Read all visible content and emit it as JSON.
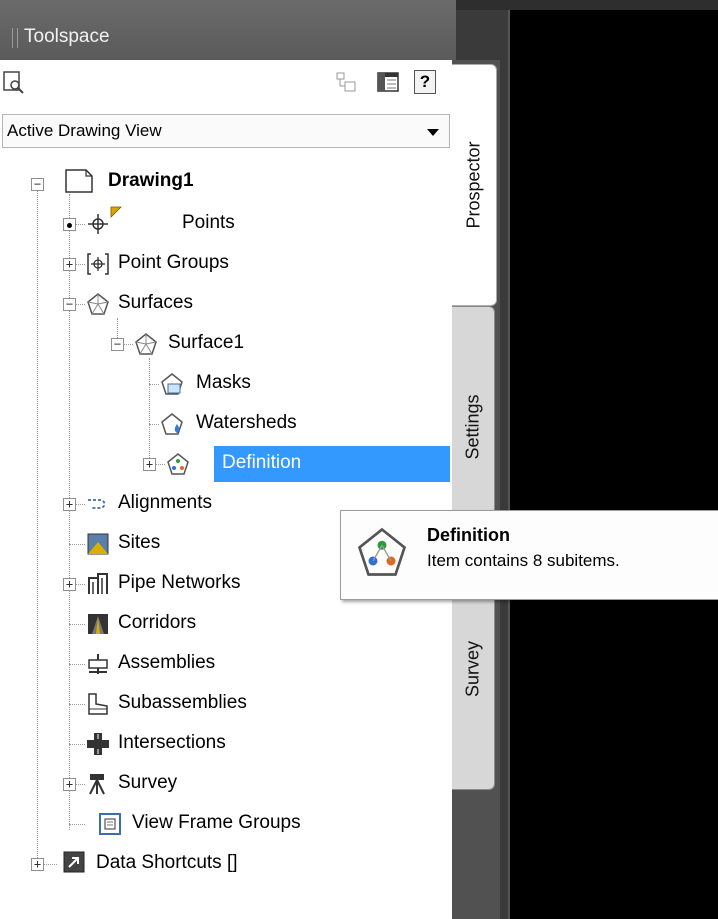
{
  "window": {
    "title": "Toolspace"
  },
  "toolbar": {
    "search_icon": "document-search-icon",
    "icons": [
      "hierarchy-view-icon",
      "item-view-icon",
      "help-icon"
    ],
    "help_label": "?"
  },
  "view_select": {
    "value": "Active Drawing View"
  },
  "tabs": [
    {
      "label": "Prospector",
      "active": true
    },
    {
      "label": "Settings",
      "active": false
    },
    {
      "label": "Survey",
      "active": false
    }
  ],
  "tree": {
    "root": "Drawing1",
    "points": "Points",
    "point_groups": "Point Groups",
    "surfaces": "Surfaces",
    "surface1": "Surface1",
    "masks": "Masks",
    "watersheds": "Watersheds",
    "definition": "Definition",
    "alignments": "Alignments",
    "sites": "Sites",
    "pipe_networks": "Pipe Networks",
    "corridors": "Corridors",
    "assemblies": "Assemblies",
    "subassemblies": "Subassemblies",
    "intersections": "Intersections",
    "survey": "Survey",
    "view_frame_groups": "View Frame Groups",
    "data_shortcuts": "Data Shortcuts []"
  },
  "tooltip": {
    "title": "Definition",
    "subtitle": "Item contains 8 subitems."
  },
  "colors": {
    "selection": "#3399ff",
    "canvas": "#000000",
    "panel_bg": "#ffffff",
    "titlebar": "#5f5f5f"
  }
}
